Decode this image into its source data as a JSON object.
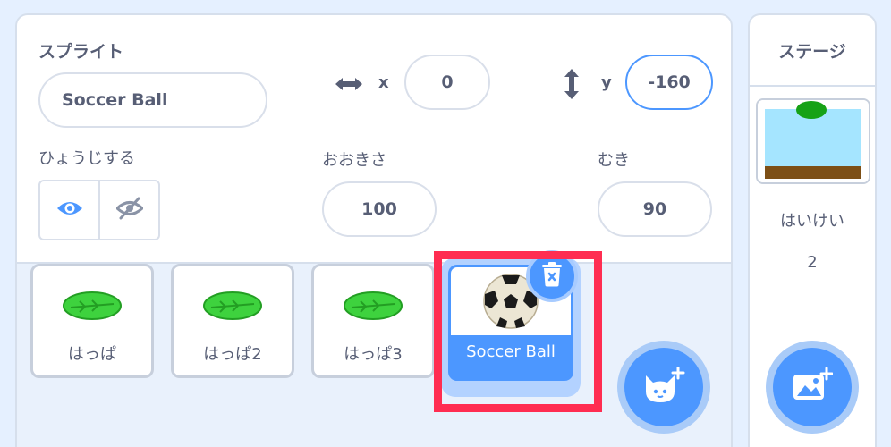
{
  "sprite": {
    "section_label": "スプライト",
    "name_value": "Soccer Ball",
    "x_label": "x",
    "x_value": "0",
    "y_label": "y",
    "y_value": "-160",
    "show_label": "ひょうじする",
    "size_label": "おおきさ",
    "size_value": "100",
    "direction_label": "むき",
    "direction_value": "90"
  },
  "sprite_list": [
    {
      "name": "はっぱ",
      "costume": "leaf"
    },
    {
      "name": "はっぱ2",
      "costume": "leaf"
    },
    {
      "name": "はっぱ3",
      "costume": "leaf"
    },
    {
      "name": "Soccer Ball",
      "costume": "soccer-ball",
      "selected": true
    }
  ],
  "stage": {
    "title": "ステージ",
    "backdrops_label": "はいけい",
    "backdrops_count": "2"
  },
  "colors": {
    "accent": "#4c97ff",
    "highlight": "#ff2d51",
    "leaf": "#3ed23e",
    "sky": "#a5e5ff",
    "ground": "#7d4f16"
  },
  "icons": [
    "x-arrows-icon",
    "y-arrows-icon",
    "eye-icon",
    "eye-off-icon",
    "trash-icon",
    "add-sprite-icon",
    "add-backdrop-icon"
  ]
}
